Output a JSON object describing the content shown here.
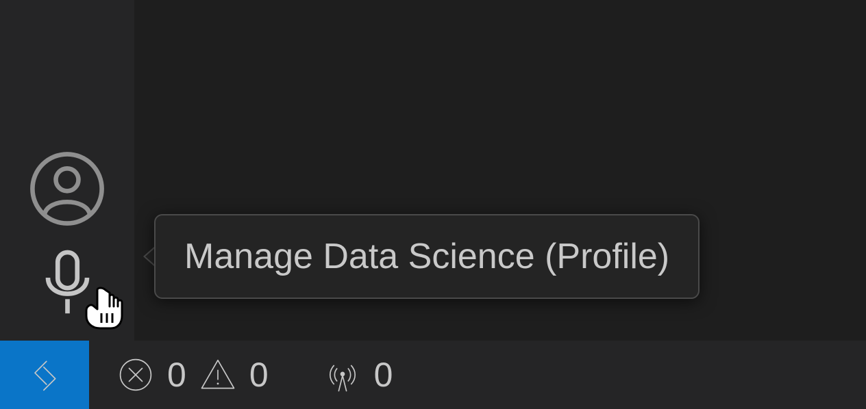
{
  "tooltip": {
    "text": "Manage Data Science (Profile)"
  },
  "status_bar": {
    "errors": "0",
    "warnings": "0",
    "ports": "0"
  }
}
